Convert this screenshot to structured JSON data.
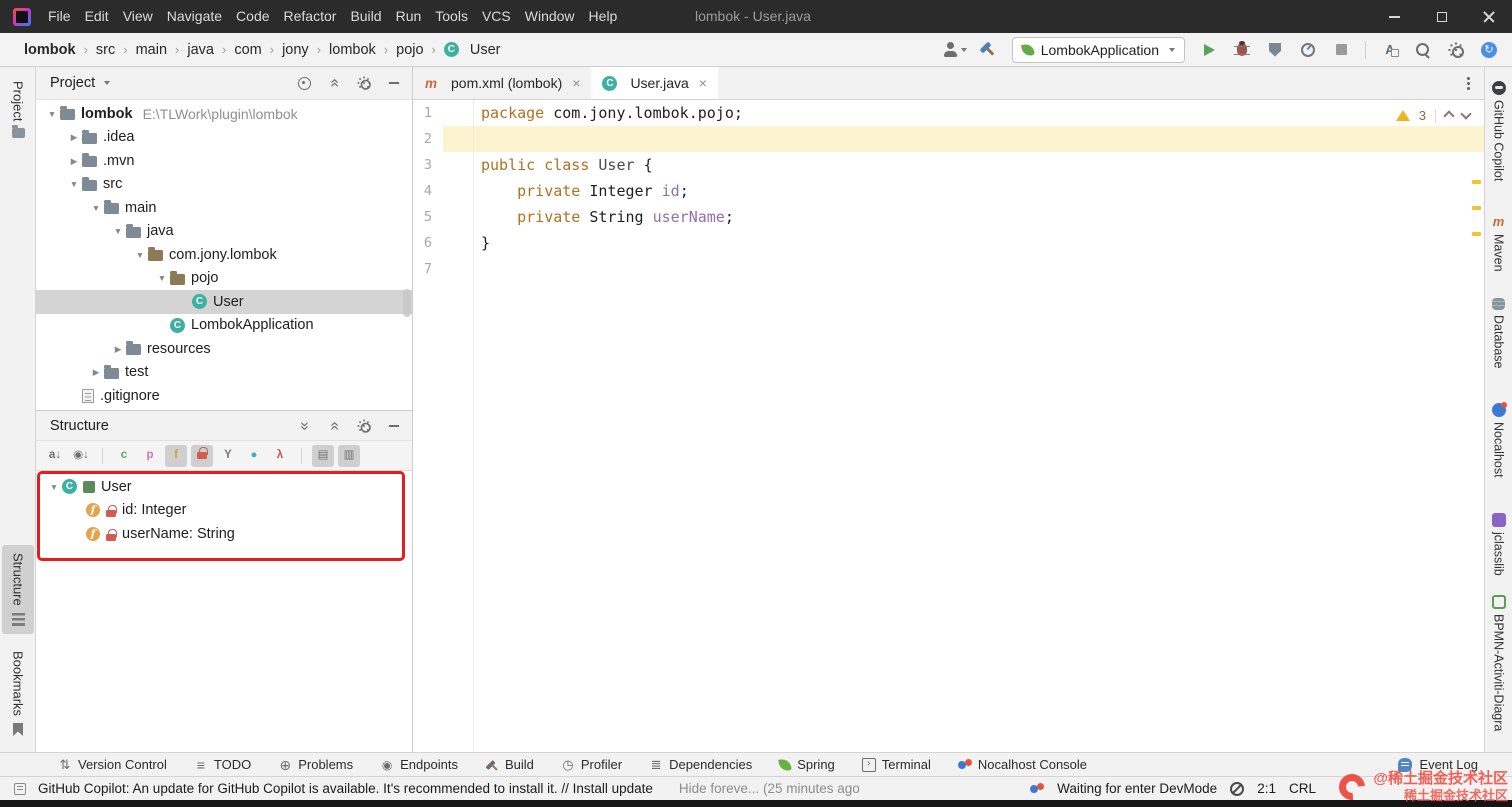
{
  "colors": {
    "keyword_orange": "#b3701f",
    "field_purple": "#8f6fae",
    "annotation_red": "#e81c1c",
    "selection_gray": "#d4d4d4",
    "run_green": "#5aa25c",
    "warning_yellow": "#efb41e",
    "watermark_red": "#f0544a"
  },
  "titlebar": {
    "title": "lombok - User.java",
    "menus": [
      "File",
      "Edit",
      "View",
      "Navigate",
      "Code",
      "Refactor",
      "Build",
      "Run",
      "Tools",
      "VCS",
      "Window",
      "Help"
    ]
  },
  "navbar": {
    "breadcrumbs": [
      {
        "label": "lombok",
        "bold": true
      },
      {
        "label": "src"
      },
      {
        "label": "main"
      },
      {
        "label": "java"
      },
      {
        "label": "com"
      },
      {
        "label": "jony"
      },
      {
        "label": "lombok"
      },
      {
        "label": "pojo"
      },
      {
        "label": "User",
        "icon": "class"
      }
    ],
    "run_config": "LombokApplication"
  },
  "left_stripe": {
    "items": [
      {
        "label": "Project",
        "active": false
      },
      {
        "label": "Structure",
        "active": true
      },
      {
        "label": "Bookmarks",
        "active": false
      }
    ]
  },
  "right_stripe": {
    "items": [
      {
        "label": "GitHub Copilot",
        "icon": "copilot"
      },
      {
        "label": "Maven",
        "icon": "maven"
      },
      {
        "label": "Database",
        "icon": "database"
      },
      {
        "label": "Nocalhost",
        "icon": "nocalhost"
      },
      {
        "label": "jclasslib",
        "icon": "jclasslib"
      },
      {
        "label": "BPMN-Activiti-Diagra",
        "icon": "bpmn"
      }
    ]
  },
  "project_panel": {
    "title": "Project",
    "tree": [
      {
        "indent": 0,
        "chevron": "expanded",
        "icon": "folder",
        "label": "lombok",
        "suffix": "E:\\TLWork\\plugin\\lombok",
        "bold": true
      },
      {
        "indent": 1,
        "chevron": "collapsed",
        "icon": "folder",
        "label": ".idea"
      },
      {
        "indent": 1,
        "chevron": "collapsed",
        "icon": "folder",
        "label": ".mvn"
      },
      {
        "indent": 1,
        "chevron": "expanded",
        "icon": "folder",
        "label": "src"
      },
      {
        "indent": 2,
        "chevron": "expanded",
        "icon": "folder",
        "label": "main"
      },
      {
        "indent": 3,
        "chevron": "expanded",
        "icon": "folder",
        "label": "java"
      },
      {
        "indent": 4,
        "chevron": "expanded",
        "icon": "package",
        "label": "com.jony.lombok"
      },
      {
        "indent": 5,
        "chevron": "expanded",
        "icon": "package",
        "label": "pojo"
      },
      {
        "indent": 6,
        "icon": "class",
        "label": "User",
        "selected": true
      },
      {
        "indent": 5,
        "icon": "class",
        "label": "LombokApplication"
      },
      {
        "indent": 3,
        "chevron": "collapsed",
        "icon": "folder",
        "label": "resources"
      },
      {
        "indent": 2,
        "chevron": "collapsed",
        "icon": "folder",
        "label": "test"
      },
      {
        "indent": 1,
        "icon": "gitignore",
        "label": ".gitignore"
      }
    ]
  },
  "structure_panel": {
    "title": "Structure",
    "toolbar": [
      {
        "name": "sort-alphabetically",
        "kind": "text",
        "text": "a↓",
        "color": "#6d6d6d"
      },
      {
        "name": "sort-by-visibility",
        "kind": "text",
        "text": "◉↓",
        "color": "#6d6d6d"
      },
      {
        "name": "separator-1",
        "kind": "sep"
      },
      {
        "name": "show-anonymous-classes",
        "kind": "text",
        "text": "c",
        "color": "#59a869"
      },
      {
        "name": "show-properties",
        "kind": "text",
        "text": "p",
        "color": "#c77db1"
      },
      {
        "name": "show-fields",
        "kind": "text",
        "text": "f",
        "color": "#d79b3f",
        "pressed": true
      },
      {
        "name": "show-non-public",
        "kind": "lock",
        "pressed": true
      },
      {
        "name": "show-inherited",
        "kind": "text",
        "text": "Y",
        "color": "#7a7a7a"
      },
      {
        "name": "show-interfaces",
        "kind": "text",
        "text": "●",
        "color": "#41b0c6"
      },
      {
        "name": "show-lambdas",
        "kind": "text",
        "text": "λ",
        "color": "#c75450"
      },
      {
        "name": "separator-2",
        "kind": "sep"
      },
      {
        "name": "autoscroll-to-source",
        "kind": "text",
        "text": "▤",
        "color": "#6d6d6d",
        "pressed": true
      },
      {
        "name": "autoscroll-from-source",
        "kind": "text",
        "text": "▥",
        "color": "#6d6d6d",
        "pressed": true
      }
    ],
    "tree": [
      {
        "indent": 0,
        "chevron": "expanded",
        "icons": [
          "class",
          "modifier"
        ],
        "label": "User"
      },
      {
        "indent": 1,
        "icons": [
          "field",
          "lock"
        ],
        "label": "id: Integer"
      },
      {
        "indent": 1,
        "icons": [
          "field",
          "lock"
        ],
        "label": "userName: String"
      }
    ]
  },
  "editor": {
    "tabs": [
      {
        "label": "pom.xml (lombok)",
        "icon": "maven",
        "active": false
      },
      {
        "label": "User.java",
        "icon": "class",
        "active": true
      }
    ],
    "warnings": "3",
    "code": [
      {
        "n": "1",
        "tokens": [
          {
            "t": "package ",
            "c": "kw"
          },
          {
            "t": "com.jony.lombok.pojo;",
            "c": "pl"
          }
        ]
      },
      {
        "n": "2",
        "current": true,
        "tokens": []
      },
      {
        "n": "3",
        "tokens": [
          {
            "t": "public class ",
            "c": "kw"
          },
          {
            "t": "User ",
            "c": "cls"
          },
          {
            "t": "{",
            "c": "pl"
          }
        ]
      },
      {
        "n": "4",
        "tokens": [
          {
            "t": "    ",
            "c": "pl"
          },
          {
            "t": "private ",
            "c": "kw"
          },
          {
            "t": "Integer ",
            "c": "pl"
          },
          {
            "t": "id",
            "c": "fld"
          },
          {
            "t": ";",
            "c": "pl"
          }
        ]
      },
      {
        "n": "5",
        "tokens": [
          {
            "t": "    ",
            "c": "pl"
          },
          {
            "t": "private ",
            "c": "kw"
          },
          {
            "t": "String ",
            "c": "pl"
          },
          {
            "t": "userName",
            "c": "fld"
          },
          {
            "t": ";",
            "c": "pl"
          }
        ]
      },
      {
        "n": "6",
        "tokens": [
          {
            "t": "}",
            "c": "pl"
          }
        ]
      },
      {
        "n": "7",
        "tokens": []
      }
    ]
  },
  "bottom_bar": {
    "items": [
      {
        "label": "Version Control",
        "icon": "vcs"
      },
      {
        "label": "TODO",
        "icon": "todo"
      },
      {
        "label": "Problems",
        "icon": "problems"
      },
      {
        "label": "Endpoints",
        "icon": "endpoints"
      },
      {
        "label": "Build",
        "icon": "build"
      },
      {
        "label": "Profiler",
        "icon": "profiler"
      },
      {
        "label": "Dependencies",
        "icon": "dependencies"
      },
      {
        "label": "Spring",
        "icon": "spring"
      },
      {
        "label": "Terminal",
        "icon": "terminal"
      },
      {
        "label": "Nocalhost Console",
        "icon": "nocalhost"
      }
    ],
    "event_log": "Event Log"
  },
  "status_bar": {
    "message": "GitHub Copilot: An update for GitHub Copilot is available. It's recommended to install it. // Install update",
    "hide_link": "Hide foreve... (25 minutes ago",
    "devmode": "Waiting for enter DevMode",
    "position": "2:1",
    "line_ending": "CRL"
  },
  "watermark": {
    "line1": "@稀土掘金技术社区",
    "line2": "稀土掘金技术社区"
  }
}
